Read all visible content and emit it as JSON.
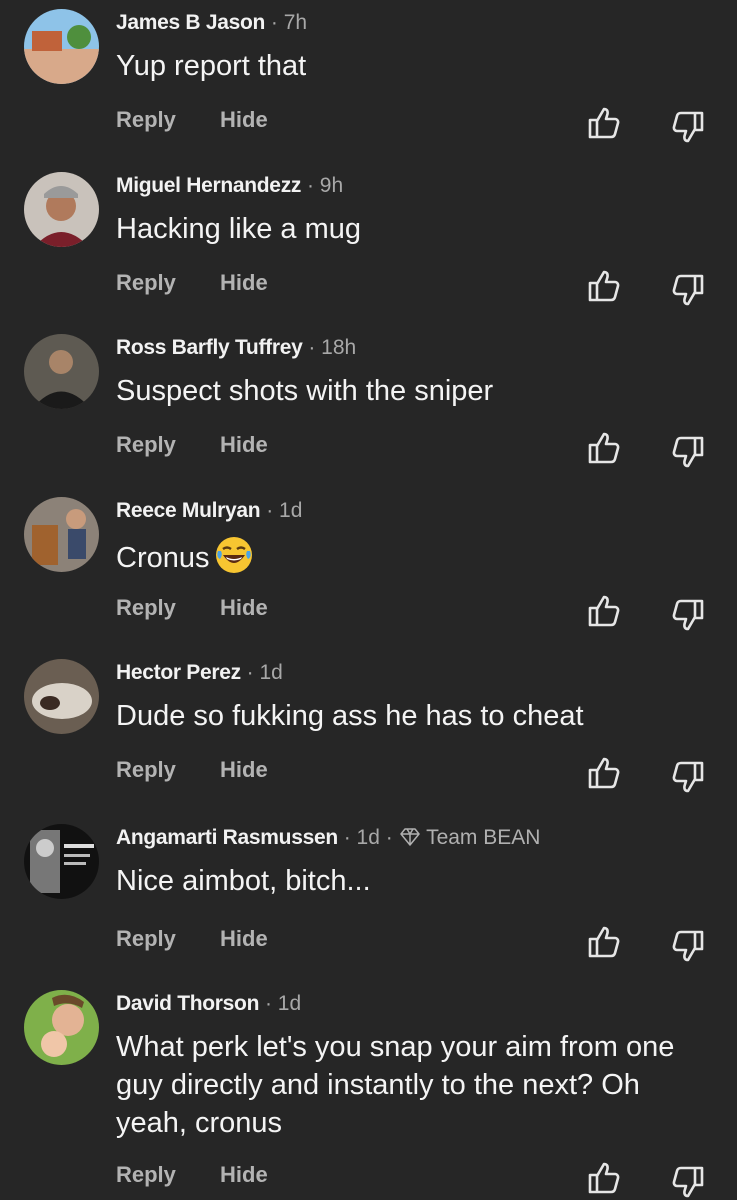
{
  "actions": {
    "reply": "Reply",
    "hide": "Hide"
  },
  "comments": [
    {
      "author": "James B Jason",
      "time": "· 7h",
      "text": "Yup report that",
      "avatar_icon": "avatar-photo"
    },
    {
      "author": "Miguel Hernandezz",
      "time": "· 9h",
      "text": "Hacking like a mug",
      "avatar_icon": "avatar-photo"
    },
    {
      "author": "Ross Barfly Tuffrey",
      "time": "· 18h",
      "text": "Suspect shots with the sniper",
      "avatar_icon": "avatar-photo"
    },
    {
      "author": "Reece Mulryan",
      "time": "· 1d",
      "text": "Cronus",
      "emoji": "laughing-tears-emoji",
      "avatar_icon": "avatar-photo"
    },
    {
      "author": "Hector Perez",
      "time": "· 1d",
      "text": "Dude so fukking ass he has to cheat",
      "avatar_icon": "avatar-photo"
    },
    {
      "author": "Angamarti Rasmussen",
      "time": "· 1d ·",
      "badge": "Team BEAN",
      "badge_icon": "diamond-icon",
      "text": "Nice aimbot, bitch...",
      "avatar_icon": "avatar-photo"
    },
    {
      "author": "David Thorson",
      "time": "· 1d",
      "text": "What perk let's you snap your aim from one guy directly and instantly to the next? Oh yeah,  cronus",
      "avatar_icon": "avatar-photo"
    }
  ],
  "colors": {
    "background": "#262626",
    "author": "#f2f2f2",
    "meta": "#a8a8a8",
    "action": "#b3b3b3"
  }
}
